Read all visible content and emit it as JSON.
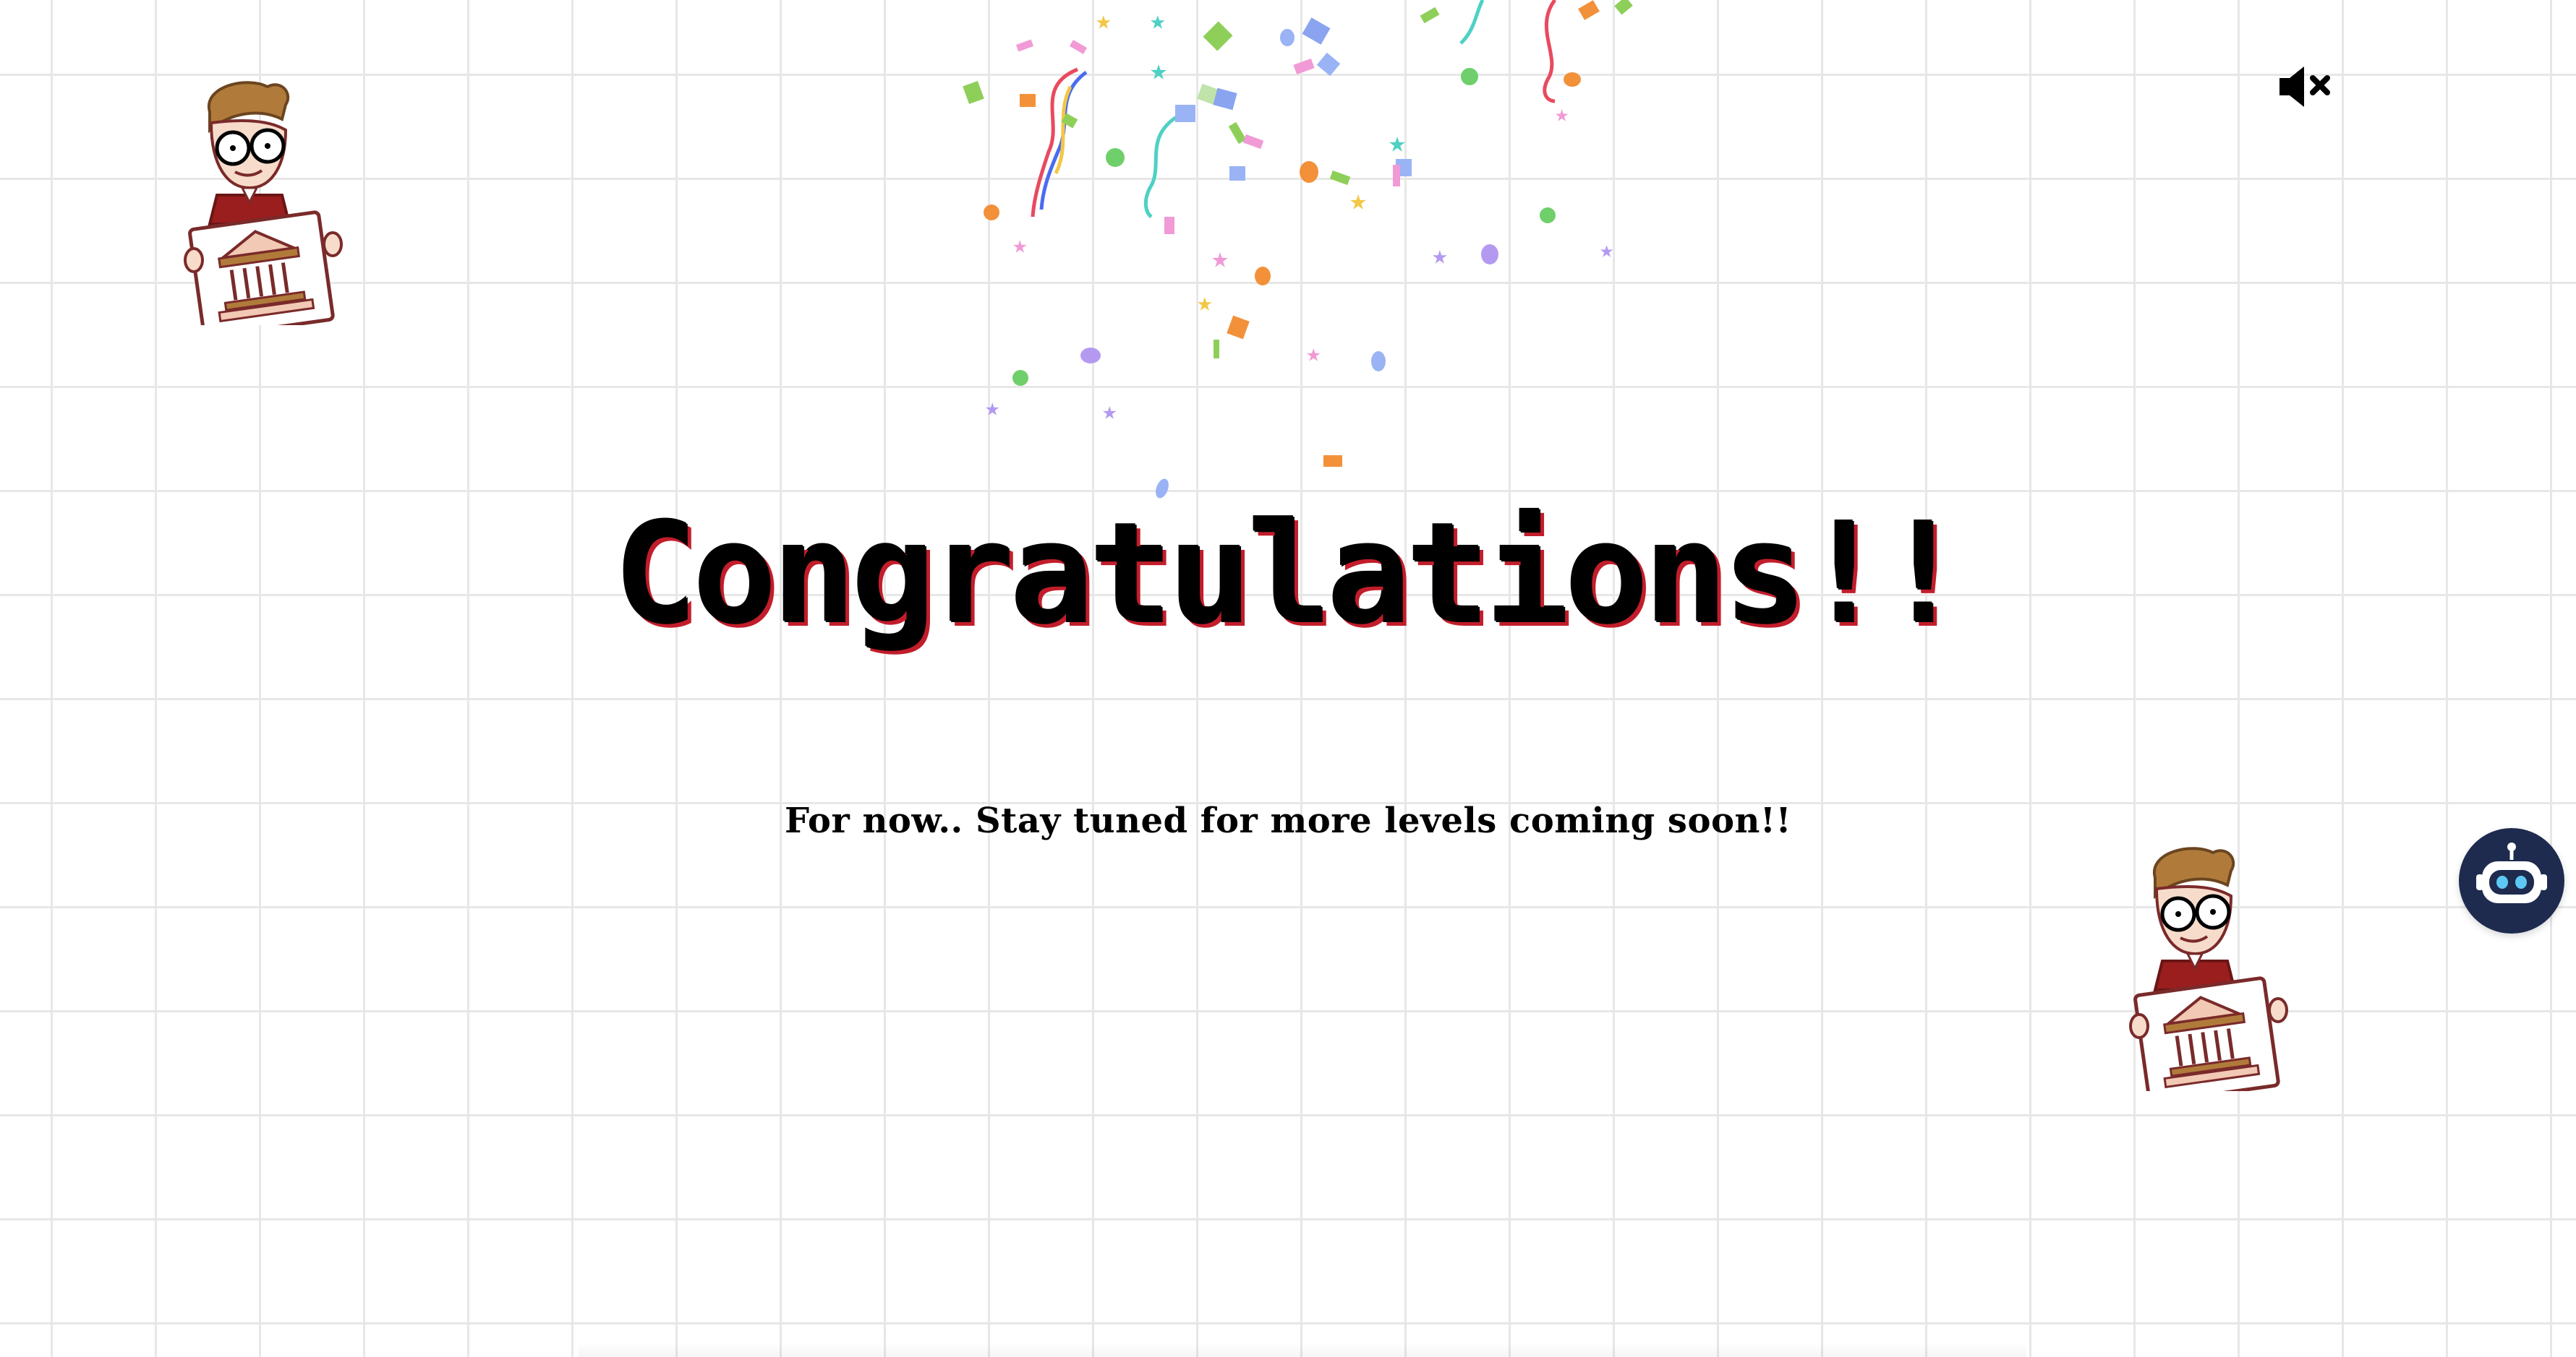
{
  "page": {
    "title": "Congratulations!!",
    "subtitle": "For now.. Stay tuned for more levels coming soon!!"
  },
  "controls": {
    "mute_icon": "speaker-muted-icon",
    "chatbot_icon": "robot-icon"
  },
  "decorations": {
    "mascot_icon": "mascot-holding-bank-sign",
    "confetti": "confetti-burst"
  },
  "colors": {
    "background": "#ffffff",
    "grid": "#e7e7e7",
    "title": "#000000",
    "title_shadow": "#c21d2b",
    "chatbot_bg": "#1e2b4f",
    "chatbot_accent": "#5ec8f5"
  }
}
